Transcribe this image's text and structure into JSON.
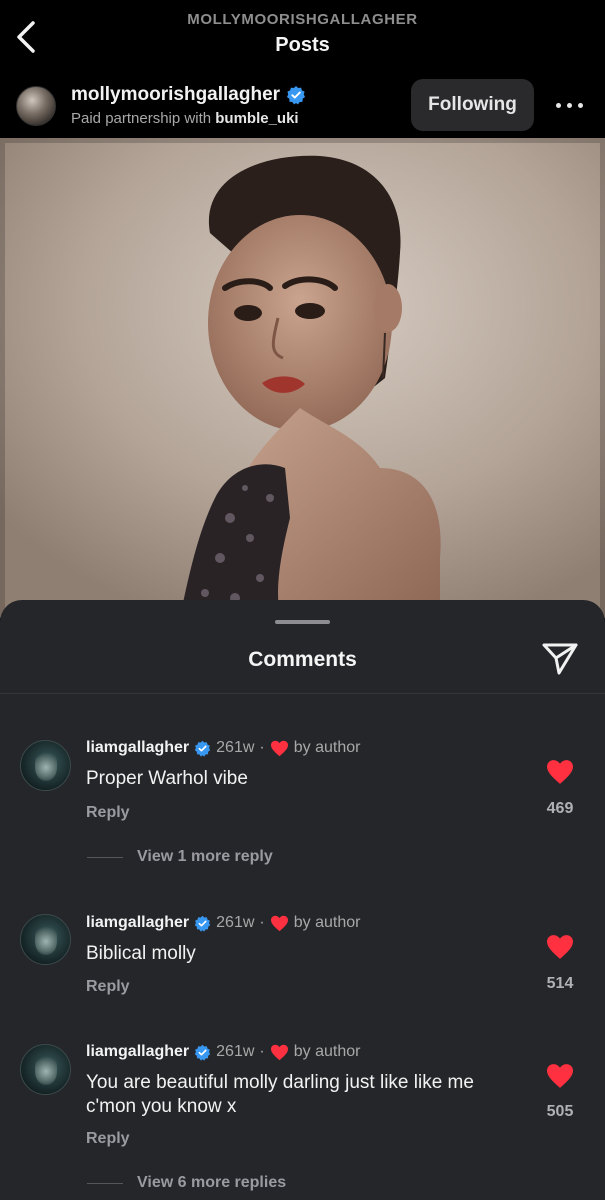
{
  "topbar": {
    "subtitle": "MOLLYMOORISHGALLAGHER",
    "title": "Posts",
    "back_icon": "chevron-left-icon"
  },
  "post": {
    "username": "mollymoorishgallagher",
    "verified_icon": "verified-badge-icon",
    "sponsor_prefix": "Paid partnership with",
    "sponsor_name": "bumble_uki",
    "follow_label": "Following",
    "more_icon": "more-horizontal-icon"
  },
  "comments_sheet": {
    "title": "Comments",
    "share_icon": "send-icon",
    "items": [
      {
        "username": "liamgallagher",
        "age": "261w",
        "separator": "·",
        "liked_by": "by author",
        "text": "Proper Warhol vibe",
        "reply_label": "Reply",
        "likes": "469",
        "view_more": "View 1 more reply"
      },
      {
        "username": "liamgallagher",
        "age": "261w",
        "separator": "·",
        "liked_by": "by author",
        "text": "Biblical molly",
        "reply_label": "Reply",
        "likes": "514"
      },
      {
        "username": "liamgallagher",
        "age": "261w",
        "separator": "·",
        "liked_by": "by author",
        "text": "You are beautiful molly darling just like like me c'mon you know x",
        "reply_label": "Reply",
        "likes": "505",
        "view_more": "View 6 more replies"
      }
    ]
  },
  "colors": {
    "background": "#000000",
    "sheet": "#25262a",
    "heart": "#ff3040",
    "verified": "#3897f0",
    "muted": "#a8a8a8"
  }
}
